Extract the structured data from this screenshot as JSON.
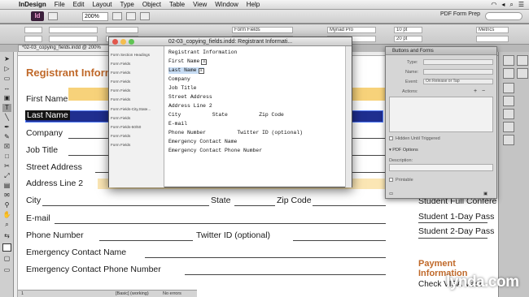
{
  "menubar": {
    "app": "InDesign",
    "items": [
      "File",
      "Edit",
      "Layout",
      "Type",
      "Object",
      "Table",
      "View",
      "Window",
      "Help"
    ]
  },
  "appbar": {
    "logo": "Id",
    "zoom": "200%",
    "workspace": "PDF Form Prep"
  },
  "control": {
    "para_style": "Form Fields",
    "char_style": "Form Fields",
    "font": "Myriad Pro",
    "size": "10 pt",
    "leading": "20 pt",
    "kerning": "Metrics"
  },
  "document": {
    "tab": "*02-03_copying_fields.indd @ 200%",
    "heading": "Registrant Information",
    "heading_right": "Payment Information",
    "fields": {
      "first_name": "First Name",
      "last_name": "Last Name",
      "company": "Company",
      "job_title": "Job Title",
      "street": "Street Address",
      "address2": "Address Line 2",
      "city": "City",
      "state": "State",
      "zip": "Zip Code",
      "email": "E-mail",
      "phone": "Phone Number",
      "twitter": "Twitter ID (optional)",
      "emergency_name": "Emergency Contact Name",
      "emergency_phone": "Emergency Contact Phone Number"
    },
    "right_column": [
      "Student Full Confere",
      "Student 1-Day Pass",
      "Student 2-Day Pass"
    ],
    "payment_partial": "Check   VISA   Mast"
  },
  "story_editor": {
    "title": "02-03_copying_fields.indd: Registrant Informati...",
    "styles": [
      "Form Section Headings",
      "Form Fields",
      "Form Fields",
      "Form Fields",
      "Form Fields",
      "Form Fields",
      "Form Fields-City,State...",
      "Form Fields",
      "Form Fields-50/50",
      "Form Fields",
      "Form Fields"
    ],
    "lines": [
      "Registrant Information",
      "First Name",
      "Last Name",
      "Company",
      "Job Title",
      "Street Address",
      "Address Line 2",
      "City          State          Zip Code",
      "E-mail",
      "Phone Number          Twitter ID (optional)",
      "Emergency Contact Name",
      "Emergency Contact Phone Number"
    ],
    "anchor_mark": "⚓"
  },
  "buttons_forms": {
    "tab": "Buttons and Forms",
    "type_label": "Type:",
    "name_label": "Name:",
    "event_label": "Event:",
    "event_value": "On Release or Tap",
    "actions_label": "Actions:",
    "hidden_label": "Hidden Until Triggered",
    "pdf_options": "PDF Options",
    "description_label": "Description:",
    "printable_label": "Printable"
  },
  "status": {
    "page": "1",
    "style": "[Basic] (working)",
    "errors": "No errors"
  },
  "watermark": "lynda.com"
}
